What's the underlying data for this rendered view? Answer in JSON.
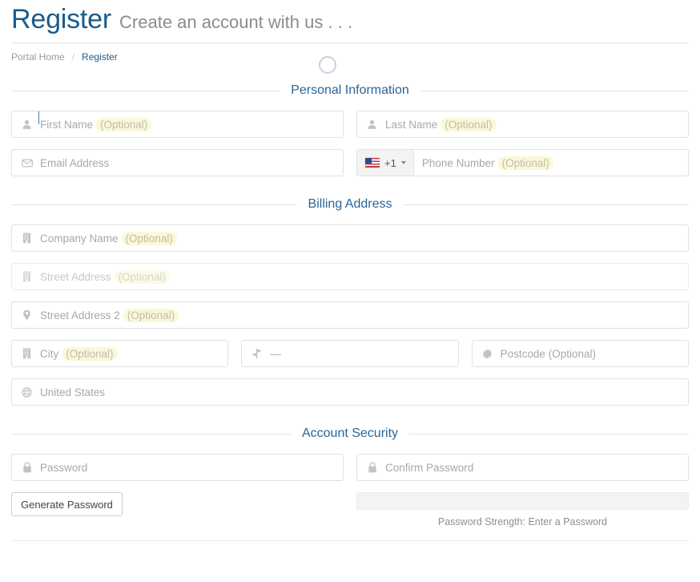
{
  "header": {
    "title": "Register",
    "subtitle": "Create an account with us . . .",
    "spinner_icon": "loading-spinner-icon"
  },
  "breadcrumb": {
    "items": [
      {
        "label": "Portal Home",
        "current": false
      },
      {
        "label": "Register",
        "current": true
      }
    ],
    "separator": "/"
  },
  "sections": [
    {
      "key": "personal",
      "title": "Personal Information"
    },
    {
      "key": "billing",
      "title": "Billing Address"
    },
    {
      "key": "security",
      "title": "Account Security"
    }
  ],
  "personal": {
    "first_name": {
      "icon": "user-icon",
      "placeholder": "First Name",
      "optional": "(Optional)",
      "value": "",
      "focused": true
    },
    "last_name": {
      "icon": "user-icon",
      "placeholder": "Last Name",
      "optional": "(Optional)",
      "value": ""
    },
    "email": {
      "icon": "envelope-icon",
      "placeholder": "Email Address",
      "value": ""
    },
    "phone": {
      "flag_icon": "us-flag-icon",
      "dial_code": "+1",
      "caret_icon": "chevron-down-icon",
      "placeholder": "Phone Number",
      "optional": "(Optional)",
      "value": ""
    }
  },
  "billing": {
    "company": {
      "icon": "building-icon",
      "placeholder": "Company Name",
      "optional": "(Optional)",
      "value": ""
    },
    "street": {
      "icon": "building-icon",
      "placeholder": "Street Address",
      "optional": "(Optional)",
      "value": "",
      "faded": true
    },
    "street2": {
      "icon": "map-pin-icon",
      "placeholder": "Street Address 2",
      "optional": "(Optional)",
      "value": ""
    },
    "city": {
      "icon": "building-icon",
      "placeholder": "City",
      "optional": "(Optional)",
      "value": ""
    },
    "state": {
      "icon": "signpost-icon",
      "value": "—"
    },
    "postcode": {
      "icon": "gear-icon",
      "placeholder": "Postcode (Optional)",
      "value": ""
    },
    "country": {
      "icon": "globe-icon",
      "value": "United States"
    }
  },
  "security": {
    "password": {
      "icon": "lock-icon",
      "placeholder": "Password",
      "value": ""
    },
    "confirm_password": {
      "icon": "lock-icon",
      "placeholder": "Confirm Password",
      "value": ""
    },
    "generate_button": "Generate Password",
    "strength_label": "Password Strength: Enter a Password",
    "strength_percent": 0
  },
  "colors": {
    "title": "#1a5b8d",
    "section_heading": "#2a6496",
    "optional_highlight": "#fbf8d8",
    "border": "#e0e0e0"
  }
}
